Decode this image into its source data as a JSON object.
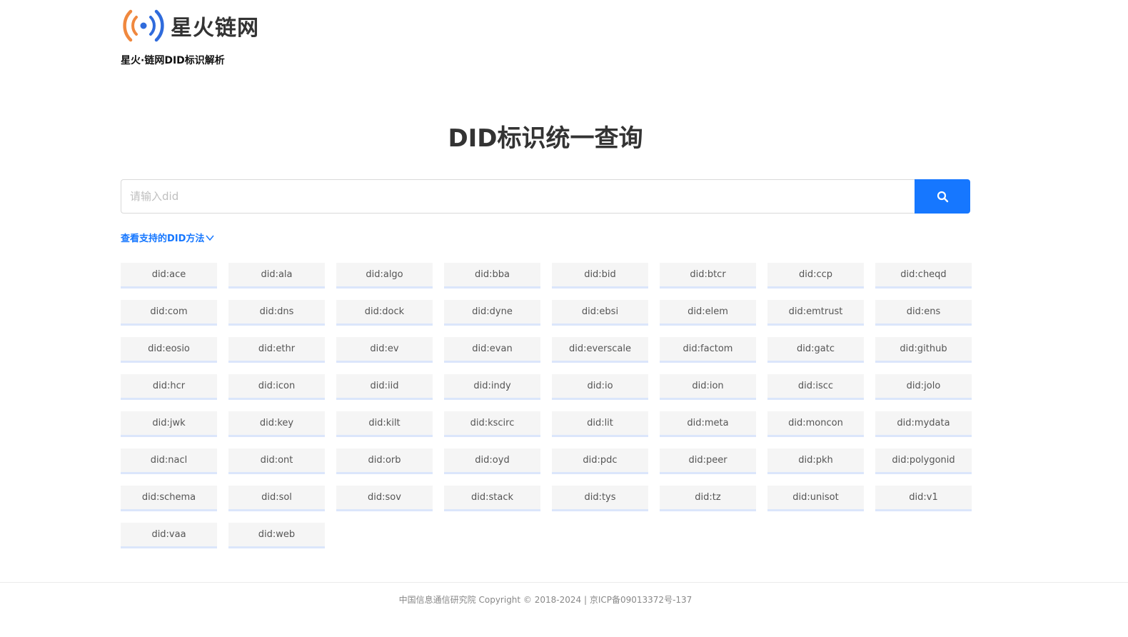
{
  "header": {
    "logo_text": "星火链网",
    "subtitle": "星火·链网DID标识解析"
  },
  "main": {
    "title": "DID标识统一查询",
    "search": {
      "placeholder": "请输入did",
      "value": ""
    },
    "methods_toggle_label": "查看支持的DID方法",
    "methods": [
      "did:ace",
      "did:ala",
      "did:algo",
      "did:bba",
      "did:bid",
      "did:btcr",
      "did:ccp",
      "did:cheqd",
      "did:com",
      "did:dns",
      "did:dock",
      "did:dyne",
      "did:ebsi",
      "did:elem",
      "did:emtrust",
      "did:ens",
      "did:eosio",
      "did:ethr",
      "did:ev",
      "did:evan",
      "did:everscale",
      "did:factom",
      "did:gatc",
      "did:github",
      "did:hcr",
      "did:icon",
      "did:iid",
      "did:indy",
      "did:io",
      "did:ion",
      "did:iscc",
      "did:jolo",
      "did:jwk",
      "did:key",
      "did:kilt",
      "did:kscirc",
      "did:lit",
      "did:meta",
      "did:moncon",
      "did:mydata",
      "did:nacl",
      "did:ont",
      "did:orb",
      "did:oyd",
      "did:pdc",
      "did:peer",
      "did:pkh",
      "did:polygonid",
      "did:schema",
      "did:sol",
      "did:sov",
      "did:stack",
      "did:tys",
      "did:tz",
      "did:unisot",
      "did:v1",
      "did:vaa",
      "did:web"
    ]
  },
  "footer": {
    "text": "中国信息通信研究院 Copyright © 2018-2024 | 京ICP备09013372号-137"
  },
  "colors": {
    "accent": "#1677ff",
    "logo_orange": "#f0883e",
    "logo_blue": "#2f6bdc",
    "tag_bg": "#f5f5f5",
    "tag_border": "#dbe6fb"
  },
  "icons": {
    "logo": "signal-broadcast-icon",
    "search": "search-icon",
    "toggle": "chevron-down-icon"
  }
}
